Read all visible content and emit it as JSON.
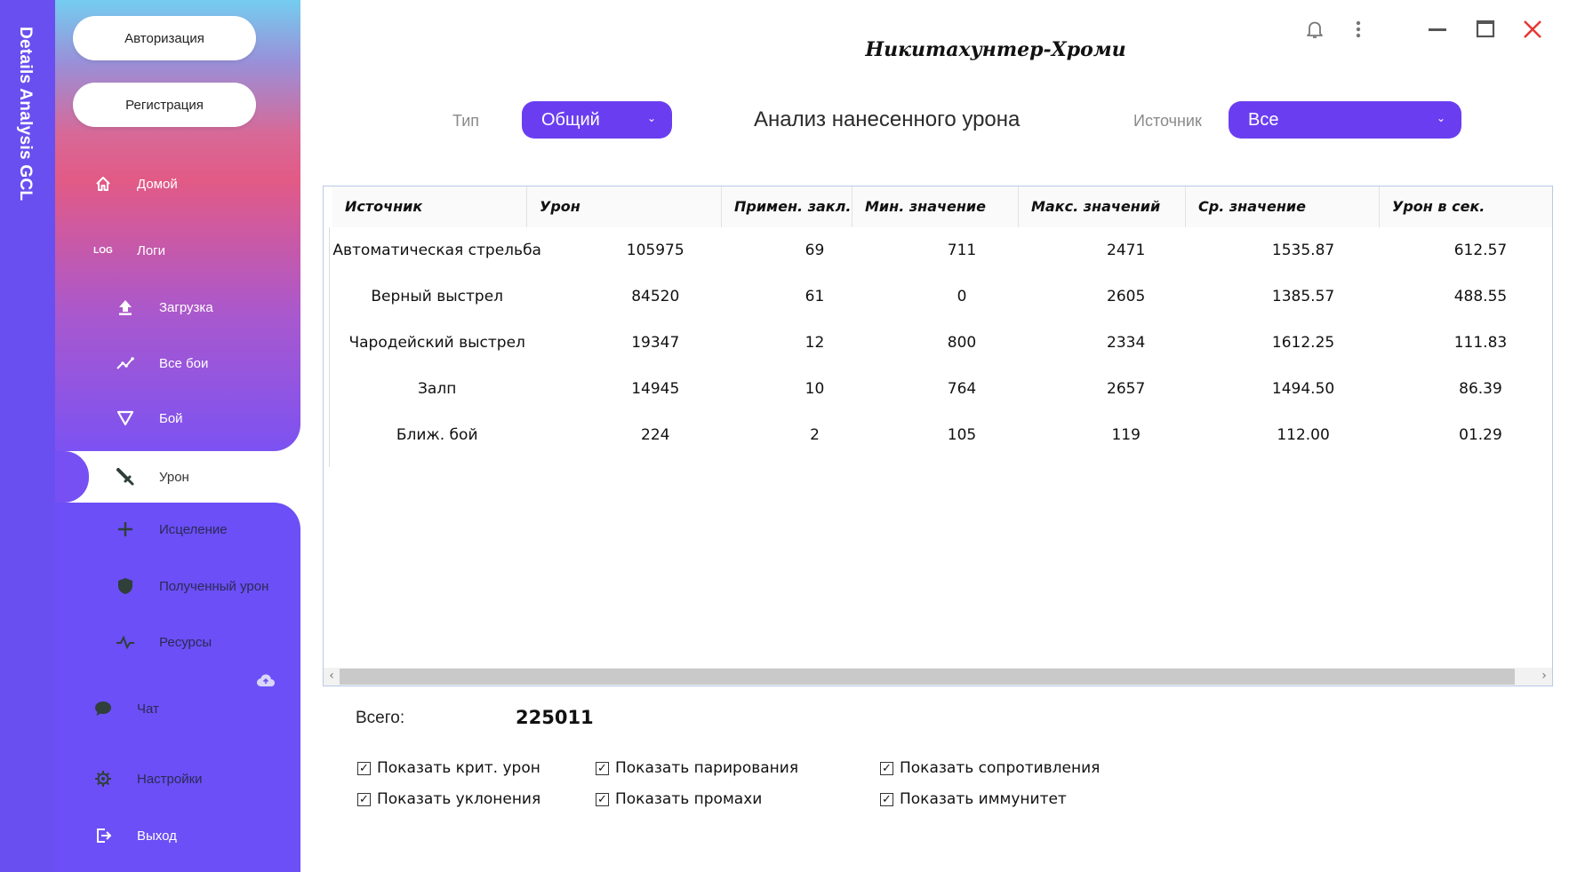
{
  "app": {
    "vertical_title": "Details Analysis GCL",
    "window_title": "Никитахунтер-Хроми"
  },
  "sidebar": {
    "login_button": "Авторизация",
    "register_button": "Регистрация",
    "items": [
      {
        "label": "Домой",
        "icon": "home-icon"
      },
      {
        "label": "Логи",
        "icon": "log-icon",
        "icon_text": "LOG"
      },
      {
        "label": "Загрузка",
        "icon": "upload-icon"
      },
      {
        "label": "Все бои",
        "icon": "chart-line-icon"
      },
      {
        "label": "Бой",
        "icon": "triangle-down-icon"
      },
      {
        "label": "Урон",
        "icon": "sword-icon",
        "active": true
      },
      {
        "label": "Исцеление",
        "icon": "plus-icon"
      },
      {
        "label": "Полученный урон",
        "icon": "shield-icon"
      },
      {
        "label": "Ресурсы",
        "icon": "pulse-icon"
      },
      {
        "label": "Чат",
        "icon": "chat-icon"
      },
      {
        "label": "Настройки",
        "icon": "gear-icon"
      },
      {
        "label": "Выход",
        "icon": "logout-icon"
      }
    ]
  },
  "filters": {
    "type_label": "Тип",
    "type_value": "Общий",
    "source_label": "Источник",
    "source_value": "Все"
  },
  "report_title": "Анализ нанесенного урона",
  "table": {
    "columns": [
      "Источник",
      "Урон",
      "Примен. закл.",
      "Мин. значение",
      "Макс. значений",
      "Ср. значение",
      "Урон в сек."
    ],
    "rows": [
      [
        "Автоматическая стрельба",
        "105975",
        "69",
        "711",
        "2471",
        "1535.87",
        "612.57"
      ],
      [
        "Верный выстрел",
        "84520",
        "61",
        "0",
        "2605",
        "1385.57",
        "488.55"
      ],
      [
        "Чародейский выстрел",
        "19347",
        "12",
        "800",
        "2334",
        "1612.25",
        "111.83"
      ],
      [
        "Залп",
        "14945",
        "10",
        "764",
        "2657",
        "1494.50",
        "86.39"
      ],
      [
        "Ближ. бой",
        "224",
        "2",
        "105",
        "119",
        "112.00",
        "01.29"
      ]
    ]
  },
  "total": {
    "label": "Всего:",
    "value": "225011"
  },
  "options": [
    {
      "label": "Показать крит. урон",
      "checked": true
    },
    {
      "label": "Показать парирования",
      "checked": true
    },
    {
      "label": "Показать сопротивления",
      "checked": true
    },
    {
      "label": "Показать уклонения",
      "checked": true
    },
    {
      "label": "Показать промахи",
      "checked": true
    },
    {
      "label": "Показать иммунитет",
      "checked": true
    }
  ],
  "colors": {
    "accent": "#6a3ef0",
    "strip": "#6a4ff0",
    "close": "#e53935"
  }
}
